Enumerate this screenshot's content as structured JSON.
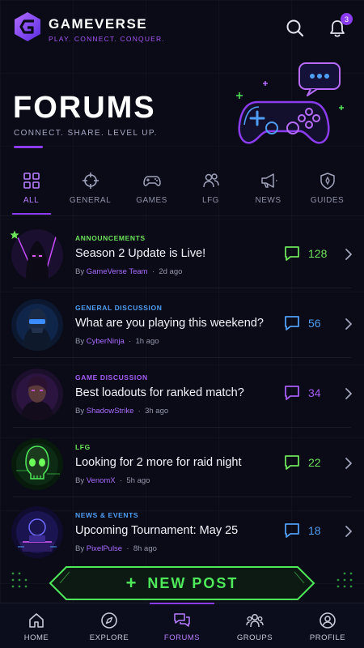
{
  "brand": {
    "name": "GAMEVERSE",
    "tagline": "PLAY. CONNECT. CONQUER."
  },
  "header": {
    "notification_count": "3",
    "icons": [
      "search-icon",
      "bell-icon"
    ]
  },
  "hero": {
    "title": "FORUMS",
    "subtitle": "CONNECT. SHARE. LEVEL UP."
  },
  "tabs": [
    {
      "label": "ALL",
      "icon": "grid-icon",
      "active": true
    },
    {
      "label": "GENERAL",
      "icon": "crosshair-icon"
    },
    {
      "label": "GAMES",
      "icon": "gamepad-icon"
    },
    {
      "label": "LFG",
      "icon": "users-icon"
    },
    {
      "label": "NEWS",
      "icon": "megaphone-icon"
    },
    {
      "label": "GUIDES",
      "icon": "shield-icon"
    }
  ],
  "threads": [
    {
      "category": "ANNOUNCEMENTS",
      "title": "Season 2 Update is Live!",
      "by": "By",
      "author": "GameVerse Team",
      "time": "2d ago",
      "comments": "128",
      "pinned": true,
      "accent": "#6be35a"
    },
    {
      "category": "GENERAL DISCUSSION",
      "title": "What are you playing this weekend?",
      "by": "By",
      "author": "CyberNinja",
      "time": "1h ago",
      "comments": "56",
      "accent": "#4f9ef5"
    },
    {
      "category": "GAME DISCUSSION",
      "title": "Best loadouts for ranked match?",
      "by": "By",
      "author": "ShadowStrike",
      "time": "3h ago",
      "comments": "34",
      "accent": "#a55cf5"
    },
    {
      "category": "LFG",
      "title": "Looking for 2 more for raid night",
      "by": "By",
      "author": "VenomX",
      "time": "5h ago",
      "comments": "22",
      "accent": "#6be35a"
    },
    {
      "category": "NEWS & EVENTS",
      "title": "Upcoming Tournament: May 25",
      "by": "By",
      "author": "PixelPulse",
      "time": "8h ago",
      "comments": "18",
      "accent": "#4f9ef5"
    }
  ],
  "new_post": {
    "label": "NEW POST",
    "plus": "+"
  },
  "bottom_nav": [
    {
      "label": "HOME",
      "icon": "home-icon"
    },
    {
      "label": "EXPLORE",
      "icon": "compass-icon"
    },
    {
      "label": "FORUMS",
      "icon": "chat-icon",
      "active": true
    },
    {
      "label": "GROUPS",
      "icon": "groups-icon"
    },
    {
      "label": "PROFILE",
      "icon": "profile-icon"
    }
  ],
  "colors": {
    "accent": "#8b3cf0",
    "green": "#4eea5a",
    "blue": "#4f9ef5",
    "background": "#0a0b16"
  }
}
